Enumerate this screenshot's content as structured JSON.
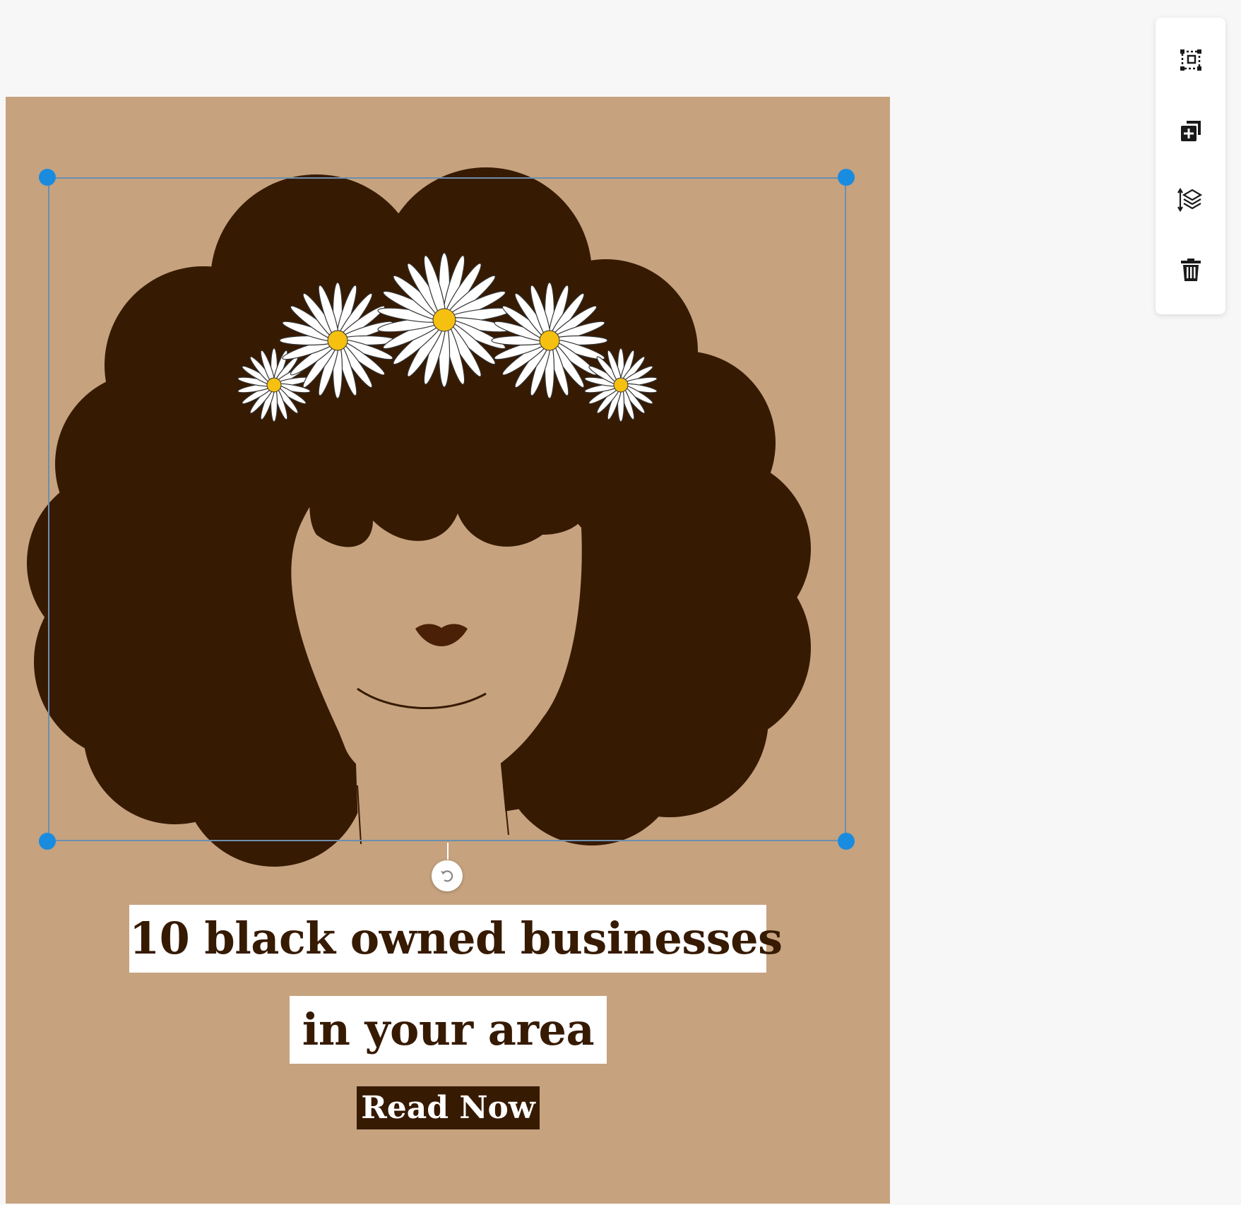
{
  "design": {
    "headline_line1": "10 black owned businesses",
    "headline_line2": "in your area",
    "cta_label": "Read Now"
  },
  "toolbar": {
    "tools": [
      {
        "icon": "group-select-icon"
      },
      {
        "icon": "duplicate-icon"
      },
      {
        "icon": "layers-icon"
      },
      {
        "icon": "trash-icon"
      }
    ]
  },
  "colors": {
    "canvas_background": "#c6a27e",
    "hair": "#361a02",
    "skin": "#c6a27e",
    "lips": "#4a2106",
    "daisy_petal": "#ffffff",
    "daisy_center": "#f5c010",
    "text_dark": "#361a02",
    "text_box_background": "#ffffff",
    "selection_handle": "#1a8ce0",
    "selection_border": "#6c8fad",
    "page_background": "#f7f7f7"
  }
}
